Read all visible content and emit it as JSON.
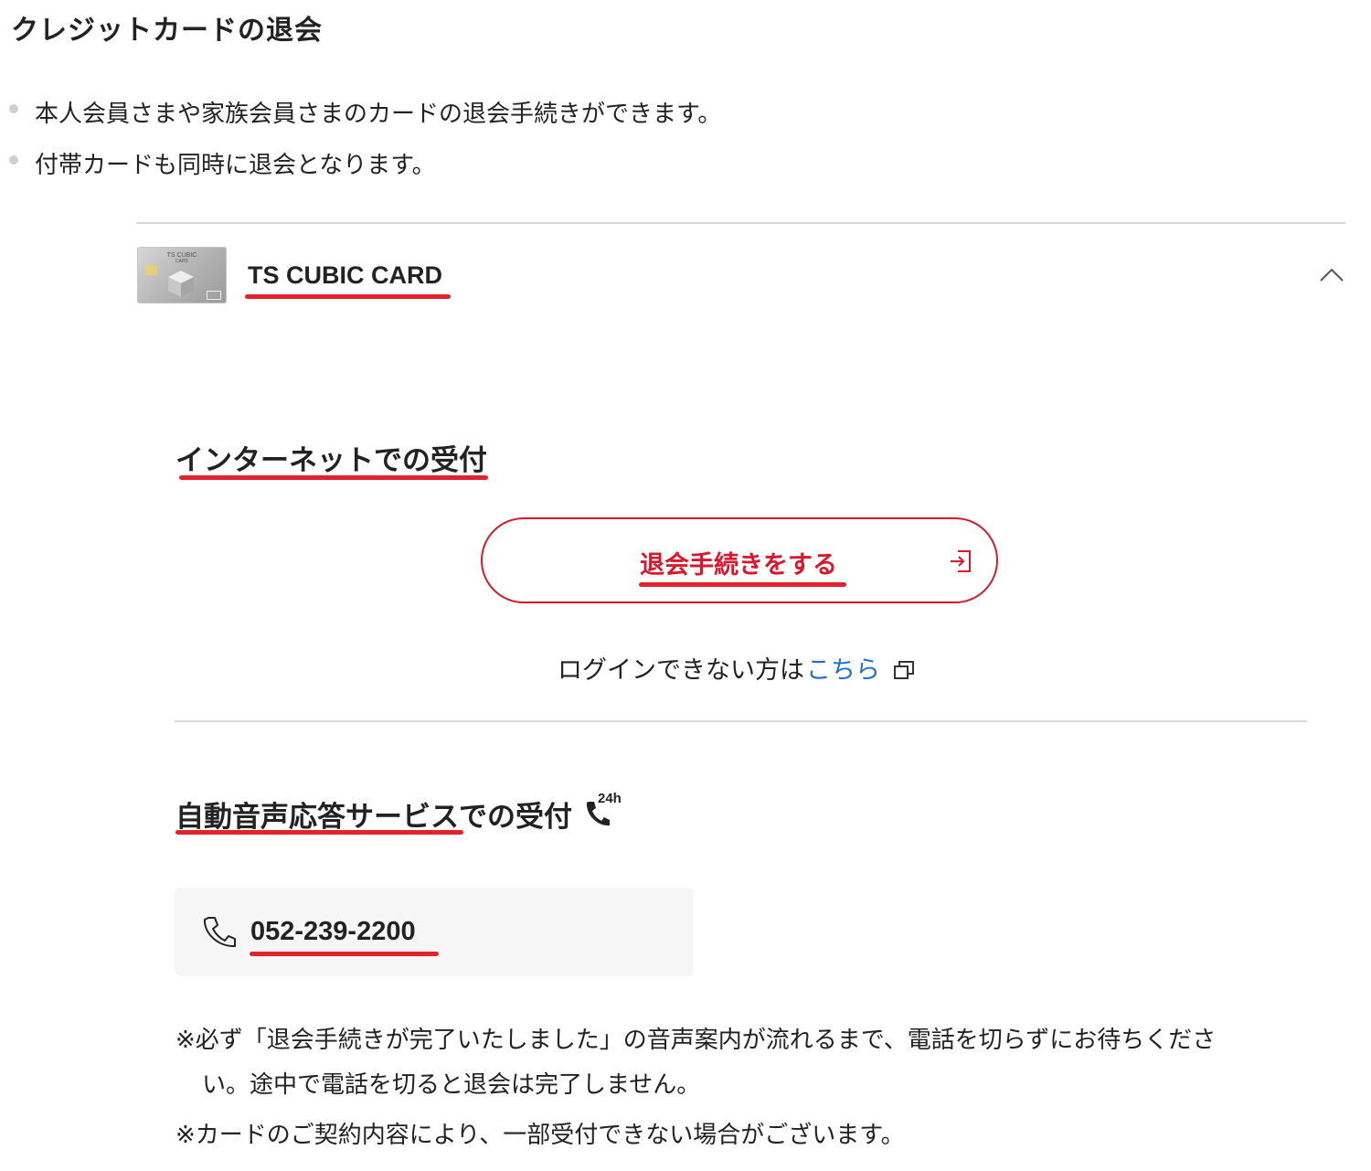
{
  "page": {
    "title": "クレジットカードの退会"
  },
  "bullets": [
    "本人会員さまや家族会員さまのカードの退会手続きができます。",
    "付帯カードも同時に退会となります。"
  ],
  "card": {
    "name": "TS CUBIC CARD",
    "thumb_brand": "TS CUBIC",
    "thumb_sub": "CARD",
    "expanded_icon": "chevron-up-icon"
  },
  "internet": {
    "title": "インターネットでの受付",
    "button_label": "退会手続きをする",
    "button_icon": "external-login-icon",
    "login_prefix": "ログインできない方は",
    "login_link": "こちら",
    "link_icon": "new-window-icon"
  },
  "voice": {
    "title": "自動音声応答サービスでの受付",
    "badge": "24h",
    "badge_icon": "phone-24h-icon",
    "phone_icon": "phone-icon",
    "phone": "052-239-2200"
  },
  "notes": {
    "note1_line1": "※必ず「退会手続きが完了いたしました」の音声案内が流れるまで、電話を切らずにお待ちくださ",
    "note1_line2": "い。途中で電話を切ると退会は完了しません。",
    "note2": "※カードのご契約内容により、一部受付できない場合がございます。"
  },
  "colors": {
    "accent_red": "#d9182b",
    "underline_red": "#e2232d",
    "link_blue": "#1f6fd1",
    "phone_box_bg": "#f6f6f6",
    "divider": "#d9d9d9"
  }
}
